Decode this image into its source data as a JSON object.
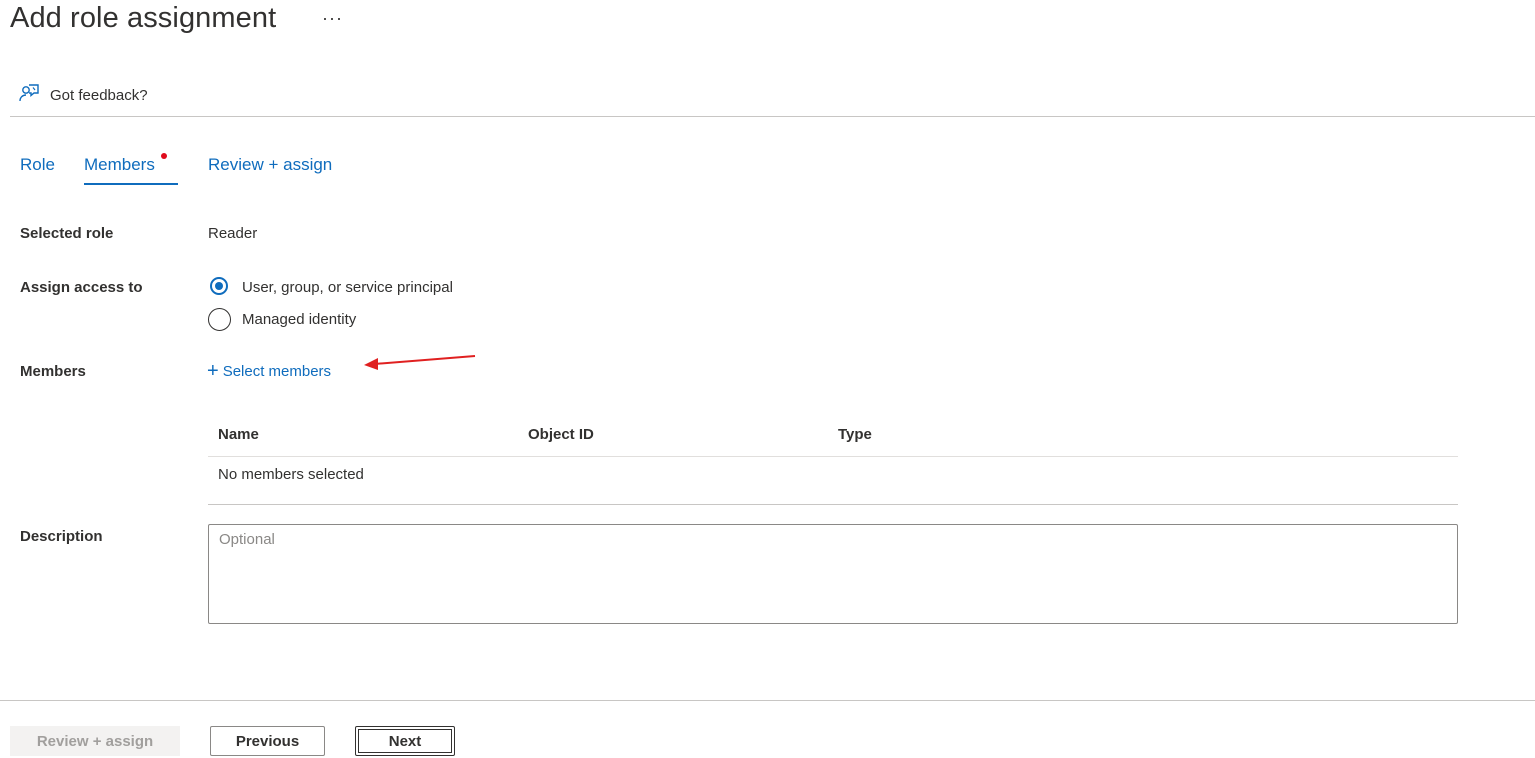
{
  "header": {
    "title": "Add role assignment",
    "more_label": "···"
  },
  "feedback": {
    "label": "Got feedback?",
    "icon": "feedback-icon"
  },
  "tabs": [
    {
      "label": "Role"
    },
    {
      "label": "Members",
      "active": true,
      "indicator": "required-dot"
    },
    {
      "label": "Review + assign"
    }
  ],
  "form": {
    "selected_role": {
      "label": "Selected role",
      "value": "Reader"
    },
    "assign_access": {
      "label": "Assign access to",
      "options": [
        {
          "label": "User, group, or service principal",
          "checked": true
        },
        {
          "label": "Managed identity",
          "checked": false
        }
      ]
    },
    "members": {
      "label": "Members",
      "select_label": "Select members",
      "table": {
        "columns": [
          "Name",
          "Object ID",
          "Type"
        ],
        "empty_text": "No members selected"
      }
    },
    "description": {
      "label": "Description",
      "placeholder": "Optional",
      "value": ""
    }
  },
  "footer": {
    "review_label": "Review + assign",
    "previous_label": "Previous",
    "next_label": "Next"
  },
  "colors": {
    "accent": "#0f6cbd",
    "required_dot": "#e00b1c",
    "annotation_arrow": "#e02020"
  }
}
